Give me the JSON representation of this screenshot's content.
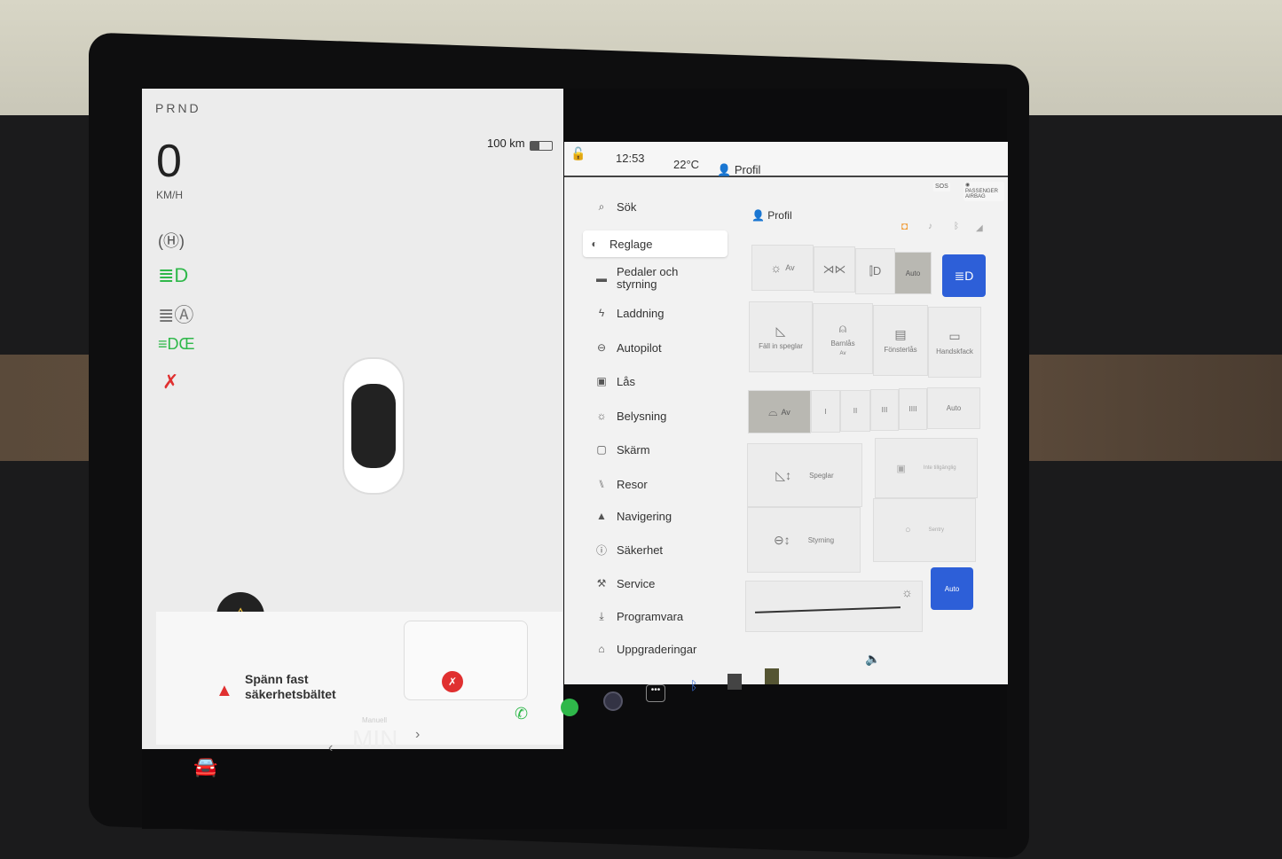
{
  "left_panel": {
    "gear": "PRND",
    "speed": "0",
    "speed_unit": "KM/H",
    "range": "100 km",
    "telltales": [
      "parking-brake-icon",
      "low-beam-icon",
      "auto-high-beam-icon",
      "parking-lights-icon",
      "seatbelt-warning-icon"
    ],
    "alert": {
      "text_line1": "Spänn fast",
      "text_line2": "säkerhetsbältet"
    }
  },
  "status_bar": {
    "time": "12:53",
    "temperature": "22°C",
    "profile": "Profil"
  },
  "menu": {
    "items": [
      {
        "label": "Sök",
        "icon": "search-icon"
      },
      {
        "label": "Reglage",
        "icon": "toggle-icon",
        "active": true
      },
      {
        "label": "Pedaler och styrning",
        "icon": "car-icon"
      },
      {
        "label": "Laddning",
        "icon": "bolt-icon"
      },
      {
        "label": "Autopilot",
        "icon": "steering-wheel-icon"
      },
      {
        "label": "Lås",
        "icon": "lock-icon"
      },
      {
        "label": "Belysning",
        "icon": "sun-icon"
      },
      {
        "label": "Skärm",
        "icon": "display-icon"
      },
      {
        "label": "Resor",
        "icon": "trips-icon"
      },
      {
        "label": "Navigering",
        "icon": "navigation-icon"
      },
      {
        "label": "Säkerhet",
        "icon": "safety-icon"
      },
      {
        "label": "Service",
        "icon": "wrench-icon"
      },
      {
        "label": "Programvara",
        "icon": "download-icon"
      },
      {
        "label": "Uppgraderingar",
        "icon": "bag-icon"
      }
    ]
  },
  "controls": {
    "profile": "Profil",
    "lights": {
      "off": "Av",
      "auto": "Auto",
      "selected": "Auto",
      "high_beam_active": true
    },
    "tiles": [
      {
        "label": "Fäll in speglar"
      },
      {
        "label": "Barnlås",
        "sub": "Av"
      },
      {
        "label": "Fönsterlås"
      },
      {
        "label": "Handskfack"
      }
    ],
    "wipers": {
      "off": "Av",
      "speeds": [
        "I",
        "II",
        "III",
        "IIII"
      ],
      "auto": "Auto",
      "selected": "Av"
    },
    "adjust": {
      "mirrors": "Speglar",
      "steering": "Styrning",
      "unavailable": "Inte tillgänglig",
      "sentry": "Sentry"
    },
    "brightness": {
      "auto": "Auto",
      "level": 0.95
    },
    "top_badges": {
      "sos": "SOS",
      "airbag": "PASSENGER AIRBAG"
    }
  },
  "dock": {
    "climate_mode": "Manuell",
    "fan": "MIN"
  },
  "colors": {
    "accent": "#2d5fd8",
    "green": "#2fb84a",
    "red": "#e03030",
    "orange": "#f0a040"
  }
}
